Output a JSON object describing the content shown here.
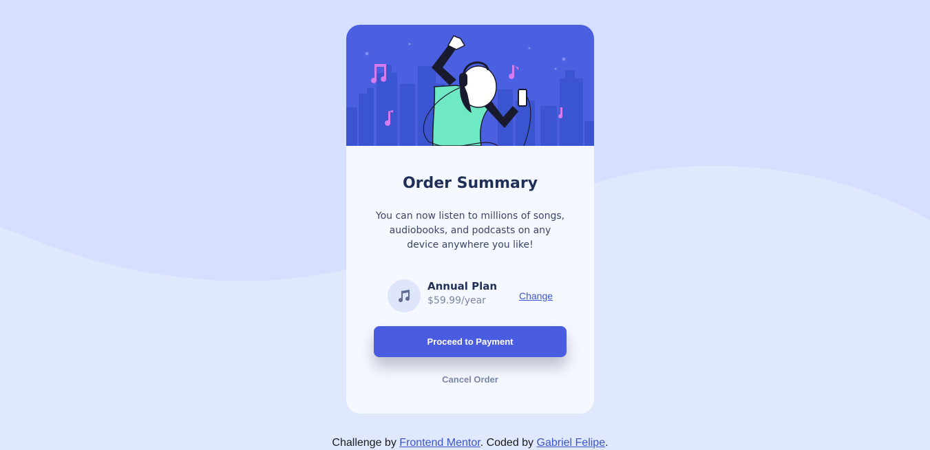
{
  "colors": {
    "page_background": "#d6e0fe",
    "card_background": "#f5f8ff",
    "hero_background": "#4a60e0",
    "primary": "#4a5ce0",
    "title": "#1f2f56",
    "muted": "#7a85a6",
    "link": "#3b55d9"
  },
  "hero": {
    "illustration": "person-dancing-with-headphones-illustration"
  },
  "card": {
    "title": "Order Summary",
    "description": "You can now listen to millions of songs, audiobooks, and podcasts on any device anywhere you like!"
  },
  "plan": {
    "icon": "music-note-icon",
    "name": "Annual Plan",
    "price": "$59.99/year",
    "change_label": "Change"
  },
  "actions": {
    "proceed_label": "Proceed to Payment",
    "cancel_label": "Cancel Order"
  },
  "footer": {
    "prefix": "Challenge by ",
    "mentor_link": "Frontend Mentor",
    "middle": ". Coded by ",
    "author_link": "Gabriel Felipe",
    "suffix": "."
  }
}
